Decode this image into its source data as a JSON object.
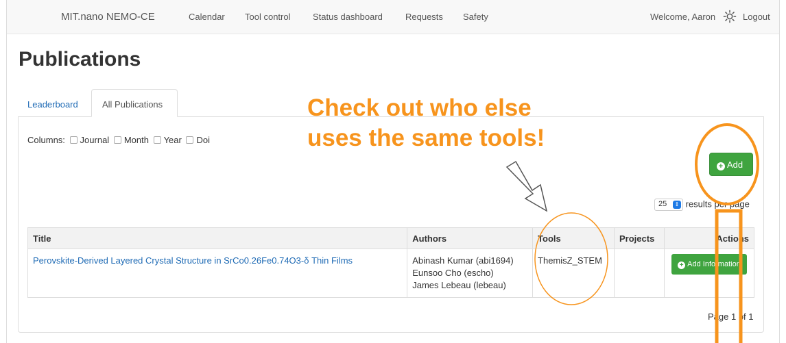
{
  "navbar": {
    "brand": "MIT.nano NEMO-CE",
    "links": [
      "Calendar",
      "Tool control",
      "Status dashboard",
      "Requests",
      "Safety"
    ],
    "welcome": "Welcome, Aaron",
    "logout": "Logout"
  },
  "page": {
    "title": "Publications"
  },
  "tabs": {
    "leaderboard": "Leaderboard",
    "all": "All Publications"
  },
  "filters": {
    "label": "Columns:",
    "options": [
      "Journal",
      "Month",
      "Year",
      "Doi"
    ]
  },
  "add_button": "Add",
  "per_page": {
    "value": "25",
    "label": "results per page"
  },
  "table": {
    "headers": [
      "Title",
      "Authors",
      "Tools",
      "Projects",
      "Actions"
    ],
    "rows": [
      {
        "title": "Perovskite-Derived Layered Crystal Structure in SrCo0.26Fe0.74O3-δ Thin Films",
        "authors": [
          "Abinash Kumar (abi1694)",
          "Eunsoo Cho (escho)",
          "James Lebeau (lebeau)"
        ],
        "tools": "ThemisZ_STEM",
        "projects": "",
        "action": "Add Information"
      }
    ]
  },
  "paging": "Page 1 of 1",
  "callout": {
    "line1": "Check out who else",
    "line2": "uses the same tools!"
  },
  "colors": {
    "accent_orange": "#f7941d",
    "btn_green": "#3fa43f",
    "link_blue": "#1f6bb5"
  }
}
